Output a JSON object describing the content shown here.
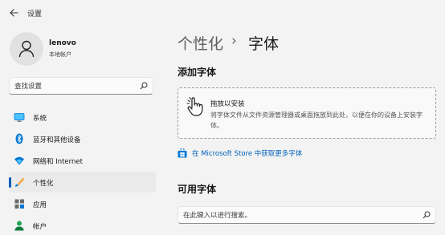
{
  "app": {
    "title": "设置",
    "back_icon": "back-arrow-icon"
  },
  "user": {
    "name": "lenovo",
    "account_type": "本地帐户",
    "avatar_icon": "person-icon"
  },
  "sidebar": {
    "search_placeholder": "查找设置",
    "items": [
      {
        "label": "系统",
        "icon": "monitor-icon",
        "active": false
      },
      {
        "label": "蓝牙和其他设备",
        "icon": "bluetooth-icon",
        "active": false
      },
      {
        "label": "网络和 Internet",
        "icon": "wifi-icon",
        "active": false
      },
      {
        "label": "个性化",
        "icon": "brush-icon",
        "active": true
      },
      {
        "label": "应用",
        "icon": "apps-icon",
        "active": false
      },
      {
        "label": "帐户",
        "icon": "account-icon",
        "active": false
      }
    ]
  },
  "breadcrumb": {
    "parent": "个性化",
    "separator": "›",
    "current": "字体"
  },
  "add_fonts": {
    "title": "添加字体",
    "drop_title": "拖放以安装",
    "drop_description": "将字体文件从文件资源管理器或桌面拖放到此处，以便在你的设备上安装字体。",
    "drop_icon": "hand-pointer-icon"
  },
  "store_link": {
    "text": "在 Microsoft Store 中获取更多字体",
    "icon": "microsoft-store-icon"
  },
  "available_fonts": {
    "title": "可用字体",
    "search_placeholder": "在此键入以进行搜索。"
  },
  "colors": {
    "accent": "#005fb8",
    "background": "#f3f3f3",
    "active_item": "#eaeaea"
  }
}
